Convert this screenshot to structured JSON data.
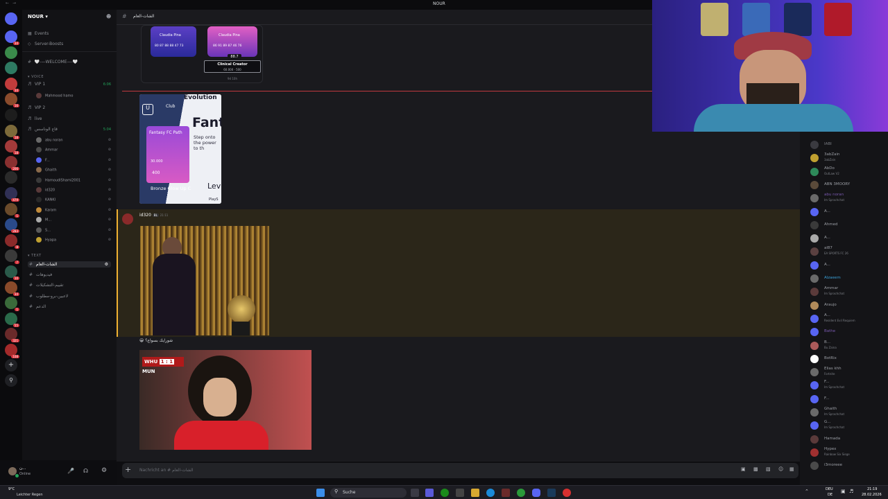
{
  "window": {
    "title": "NOUR"
  },
  "servers": [
    {
      "color": "#5865f2",
      "badge": "34"
    },
    {
      "color": "#3a8a4a",
      "badge": ""
    },
    {
      "color": "#2e7a62",
      "badge": ""
    },
    {
      "color": "#c23c3c",
      "badge": "34"
    },
    {
      "color": "#8a4b2c",
      "badge": "16"
    },
    {
      "color": "#1d1d1d",
      "badge": ""
    },
    {
      "color": "#7c6a3a",
      "badge": "18"
    },
    {
      "color": "#a33a3a",
      "badge": "18"
    },
    {
      "color": "#8a3030",
      "badge": "206"
    },
    {
      "color": "#2a2a2a",
      "badge": ""
    },
    {
      "color": "#303055",
      "badge": "479"
    },
    {
      "color": "#6a4a2a",
      "badge": "1"
    },
    {
      "color": "#2a4a8a",
      "badge": "283"
    },
    {
      "color": "#8a2a2a",
      "badge": "8"
    },
    {
      "color": "#3a3a3a",
      "badge": "7"
    },
    {
      "color": "#2a5a4a",
      "badge": "10"
    },
    {
      "color": "#8a4a2a",
      "badge": "34"
    },
    {
      "color": "#3a6a3a",
      "badge": "1"
    },
    {
      "color": "#2a6a4a",
      "badge": "55"
    },
    {
      "color": "#6a2a2a",
      "badge": "321"
    },
    {
      "color": "#a32a2a",
      "badge": "108"
    }
  ],
  "sidebar": {
    "guild_name": "NOUR",
    "top_items": [
      {
        "icon": "calendar-icon",
        "label": "Events"
      },
      {
        "icon": "boost-icon",
        "label": "Server-Boosts"
      }
    ],
    "welcome_channel": "🤍-—WELCOME—-🤍",
    "voice_section": "VOICE",
    "voice_channels": [
      {
        "label": "VIP 1",
        "timer": "6:06"
      },
      {
        "label": "VIP 2",
        "timer": ""
      },
      {
        "label": "live",
        "timer": ""
      },
      {
        "label": "قاع الوناسس",
        "timer": "5:04"
      }
    ],
    "vip1_users": [
      "Mahmood hamo"
    ],
    "voice_users": [
      "abu noran",
      "Ammar",
      "F...",
      "Ghaith",
      "HamoudIShami2001",
      "id320",
      "KANKI",
      "Karam",
      "M...",
      "S...",
      "Hyapa"
    ],
    "text_section": "TEXT",
    "text_channels": [
      "الشات-العام",
      "فيديوهات",
      "تقييم-التشكيلات",
      "لاعبين-برو-مطلوب",
      "الدعم"
    ]
  },
  "user_panel": {
    "name": "ن...",
    "status": "Online"
  },
  "channel_header": {
    "name": "الشات-العام"
  },
  "messages": {
    "cards": {
      "player_name": "Claudia Pina",
      "stat_row_1": "80 87 88 88 47 73",
      "stat_row_2": "86 91 89 87 46 76",
      "rating": "88.7",
      "evolution_name": "Clinical Creator",
      "evolution_cost": "60.000 · 500",
      "evolution_time": "9d 10h"
    },
    "evolution_card": {
      "header": "Evolution",
      "club": "Club",
      "big_text": "Fanta",
      "body": "Step onto the power to th",
      "path": "Fantasy FC Path",
      "coins": "30.000",
      "points": "400",
      "footer": "Bronze Glow Up C",
      "side": "Lev",
      "playx": "PlayS"
    },
    "author": {
      "name": "id320",
      "tag": "BL",
      "time": "21:11"
    },
    "caption": "شورايك بسواع؟",
    "score": {
      "home": "WHU",
      "score": "1 : 1",
      "away": "MUN"
    }
  },
  "composer": {
    "placeholder": "Nachricht an # الشات-العام"
  },
  "members": [
    {
      "name": "IABI",
      "status": "",
      "color": "#7c7f86",
      "av": "#3a3a40"
    },
    {
      "name": "3abZain",
      "status": "3abZain",
      "color": "#9c9fa6",
      "av": "#c0a030"
    },
    {
      "name": "AbDo",
      "status": "OutLaw V2",
      "color": "#9c9fa6",
      "av": "#2e8a5a"
    },
    {
      "name": "ABN 3MOORY",
      "status": "",
      "color": "#9c9fa6",
      "av": "#5a4a3a"
    },
    {
      "name": "abu noran",
      "status": "Im Sprachchat",
      "color": "#7a5ab0",
      "av": "#6a6a6a"
    },
    {
      "name": "A...",
      "status": "",
      "color": "#9c9fa6",
      "av": "#5865f2"
    },
    {
      "name": "Ahmed",
      "status": "",
      "color": "#9c9fa6",
      "av": "#3a3a3a"
    },
    {
      "name": "A...",
      "status": "",
      "color": "#9c9fa6",
      "av": "#aaaaaa"
    },
    {
      "name": "al87",
      "status": "EA SPORTS FC 26",
      "color": "#9c9fa6",
      "av": "#5a4040"
    },
    {
      "name": "A...",
      "status": "",
      "color": "#9c9fa6",
      "av": "#5865f2"
    },
    {
      "name": "Alzaeem",
      "status": "",
      "color": "#3aa0d8",
      "av": "#6a6a6a"
    },
    {
      "name": "Ammar",
      "status": "Im Sprachchat",
      "color": "#9c9fa6",
      "av": "#5a3a3a"
    },
    {
      "name": "Araujo",
      "status": "",
      "color": "#9c9fa6",
      "av": "#b08a5a"
    },
    {
      "name": "A...",
      "status": "Resident Evil Requiem",
      "color": "#9c9fa6",
      "av": "#5865f2"
    },
    {
      "name": "Bathe",
      "status": "",
      "color": "#7a5ab0",
      "av": "#5865f2"
    },
    {
      "name": "B...",
      "status": "Bu Zaina",
      "color": "#9c9fa6",
      "av": "#aa5a5a"
    },
    {
      "name": "BotRix",
      "status": "",
      "color": "#9c9fa6",
      "av": "#ffffff"
    },
    {
      "name": "Elias khh",
      "status": "Fortnite",
      "color": "#9c9fa6",
      "av": "#6a6a6a"
    },
    {
      "name": "F...",
      "status": "Im Sprachchat",
      "color": "#9c9fa6",
      "av": "#5865f2"
    },
    {
      "name": "F...",
      "status": "",
      "color": "#9c9fa6",
      "av": "#5865f2"
    },
    {
      "name": "Ghaith",
      "status": "Im Sprachchat",
      "color": "#9c9fa6",
      "av": "#6a6a6a"
    },
    {
      "name": "G...",
      "status": "Im Sprachchat",
      "color": "#9c9fa6",
      "av": "#5865f2"
    },
    {
      "name": "Hamada",
      "status": "",
      "color": "#9c9fa6",
      "av": "#5a3a3a"
    },
    {
      "name": "Hypex",
      "status": "Rainbow Six Siege",
      "color": "#9c9fa6",
      "av": "#a03030"
    },
    {
      "name": "i3moreee",
      "status": "",
      "color": "#9c9fa6",
      "av": "#4a4a4a"
    }
  ],
  "taskbar": {
    "weather_temp": "9°C",
    "weather_desc": "Leichter Regen",
    "search": "Suche",
    "lang": "DEU",
    "lang2": "DE",
    "time": "21:19",
    "date": "28.02.2026"
  },
  "colors": {
    "accent": "#5865f2",
    "highlight": "#2b2619",
    "online": "#23a55a"
  }
}
